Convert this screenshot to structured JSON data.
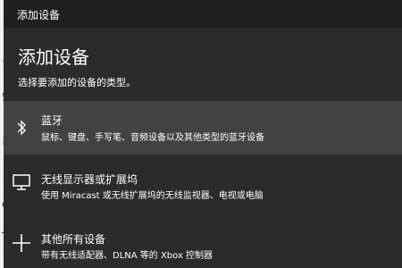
{
  "window": {
    "title": "添加设备"
  },
  "header": {
    "heading": "添加设备",
    "subheading": "选择要添加的设备的类型。"
  },
  "options": [
    {
      "icon": "bluetooth-icon",
      "title": "蓝牙",
      "description": "鼠标、键盘、手写笔、音频设备以及其他类型的蓝牙设备",
      "selected": true
    },
    {
      "icon": "monitor-icon",
      "title": "无线显示器或扩展坞",
      "description": "使用 Miracast 或无线扩展坞的无线监视器、电视或电脑",
      "selected": false
    },
    {
      "icon": "plus-icon",
      "title": "其他所有设备",
      "description": "带有无线适配器、DLNA 等的 Xbox 控制器",
      "selected": false
    }
  ],
  "colors": {
    "dialog_bg": "#2b2b2b",
    "titlebar_bg": "#1f1f1f",
    "selected_bg": "#424242",
    "text": "#ffffff"
  }
}
